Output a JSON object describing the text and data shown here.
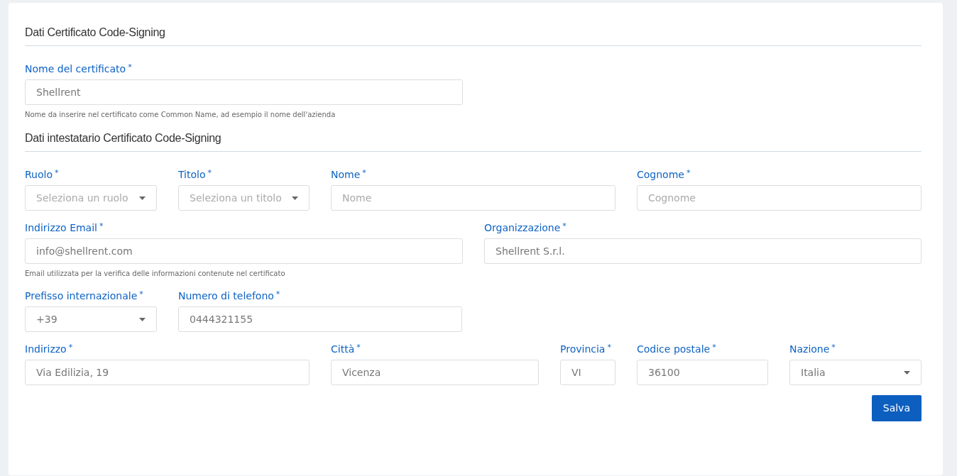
{
  "sections": [
    {
      "title": "Dati Certificato Code-Signing",
      "rows": [
        {
          "fields": [
            {
              "label": "Nome del certificato",
              "asterisk": "*",
              "kind": "input",
              "value": "Shellrent",
              "help": "Nome da inserire nel certificato come Common Name, ad esempio il nome dell'azienda"
            }
          ]
        }
      ]
    },
    {
      "title": "Dati intestatario Certificato Code-Signing",
      "rows": [
        {
          "fields": [
            {
              "label": "Ruolo",
              "asterisk": "*",
              "kind": "select",
              "placeholder": "Seleziona un ruolo"
            },
            {
              "label": "Titolo",
              "asterisk": "*",
              "kind": "select",
              "placeholder": "Seleziona un titolo"
            },
            {
              "label": "Nome",
              "asterisk": "*",
              "kind": "input",
              "placeholder": "Nome"
            },
            {
              "label": "Cognome",
              "asterisk": "*",
              "kind": "input",
              "placeholder": "Cognome"
            }
          ]
        },
        {
          "fields": [
            {
              "label": "Indirizzo Email",
              "asterisk": "*",
              "kind": "input",
              "value": "info@shellrent.com",
              "help": "Email utilizzata per la verifica delle informazioni contenute nel certificato"
            },
            {
              "label": "Organizzazione",
              "asterisk": "*",
              "kind": "input",
              "value": "Shellrent S.r.l."
            }
          ]
        },
        {
          "fields": [
            {
              "label": "Prefisso internazionale",
              "asterisk": "*",
              "kind": "select",
              "value": "+39"
            },
            {
              "label": "Numero di telefono",
              "asterisk": "*",
              "kind": "input",
              "value": "0444321155"
            }
          ]
        },
        {
          "fields": [
            {
              "label": "Indirizzo",
              "asterisk": "*",
              "kind": "input",
              "value": "Via Edilizia, 19"
            },
            {
              "label": "Città",
              "asterisk": "*",
              "kind": "input",
              "value": "Vicenza"
            },
            {
              "label": "Provincia",
              "asterisk": "*",
              "kind": "input",
              "value": "VI"
            },
            {
              "label": "Codice postale",
              "asterisk": "*",
              "kind": "input",
              "value": "36100"
            },
            {
              "label": "Nazione",
              "asterisk": "*",
              "kind": "select",
              "value": "Italia"
            }
          ]
        }
      ]
    }
  ],
  "save_button": "Salva"
}
